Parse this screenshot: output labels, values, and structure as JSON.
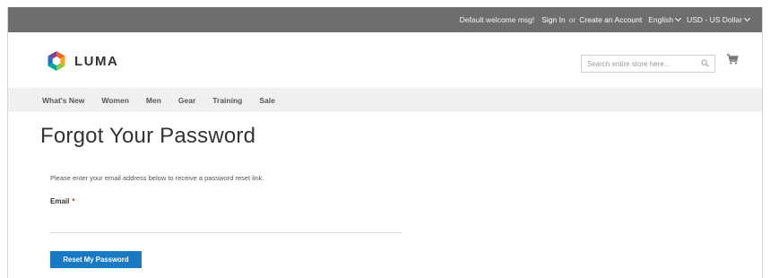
{
  "topbar": {
    "welcome": "Default welcome msg!",
    "sign_in": "Sign In",
    "or": "or",
    "create_account": "Create an Account",
    "language": "English",
    "currency": "USD - US Dollar"
  },
  "header": {
    "logo_text": "LUMA",
    "search_placeholder": "Search entire store here...",
    "search_icon": "search-icon",
    "cart_icon": "cart-icon"
  },
  "nav": {
    "items": [
      {
        "label": "What's New"
      },
      {
        "label": "Women"
      },
      {
        "label": "Men"
      },
      {
        "label": "Gear"
      },
      {
        "label": "Training"
      },
      {
        "label": "Sale"
      }
    ]
  },
  "main": {
    "title": "Forgot Your Password",
    "intro": "Please enter your email address below to receive a password reset link.",
    "email_label": "Email",
    "required_mark": "*",
    "email_value": "",
    "submit_label": "Reset My Password"
  },
  "colors": {
    "topbar_bg": "#6e6e6e",
    "nav_bg": "#f0f0f0",
    "button_bg": "#1979c3",
    "required": "#e02b27"
  }
}
